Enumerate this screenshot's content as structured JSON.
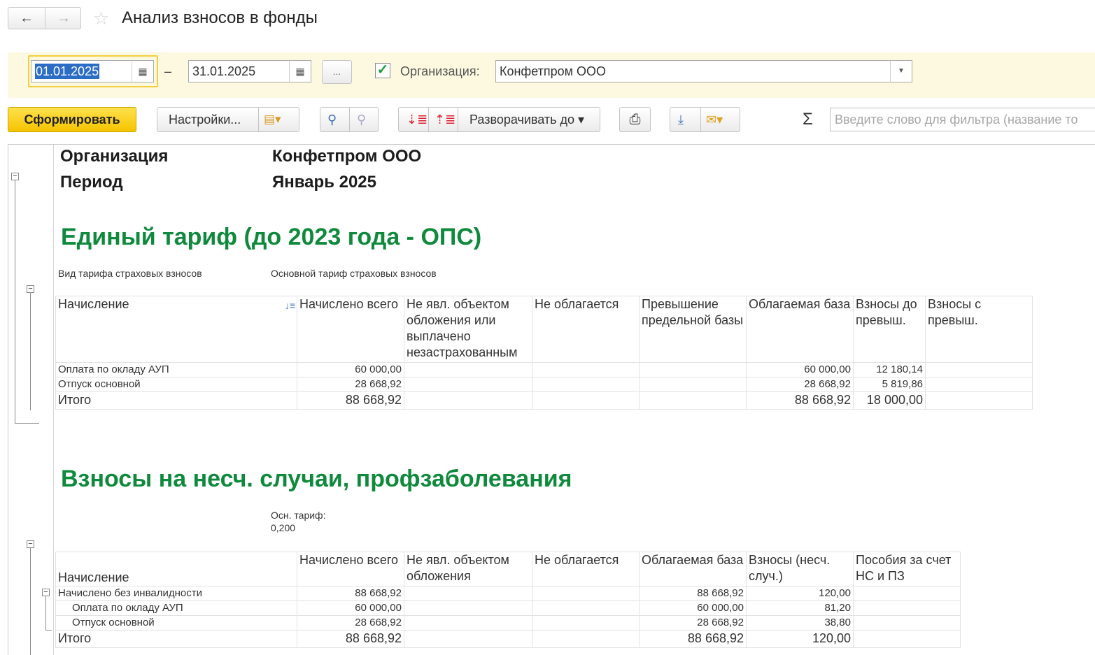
{
  "window": {
    "title": "Анализ взносов в фонды",
    "back_icon": "arrow-left-icon",
    "forward_icon": "arrow-right-icon",
    "favorite_icon": "star-icon"
  },
  "params": {
    "date_from": "01.01.2025",
    "dash": "–",
    "date_to": "31.01.2025",
    "period_button": "...",
    "org_checkbox_checked": true,
    "org_label": "Организация:",
    "org_value": "Конфетпром ООО"
  },
  "toolbar": {
    "generate": "Сформировать",
    "settings": "Настройки...",
    "expand_to": "Разворачивать до",
    "filter_placeholder": "Введите слово для фильтра (название то",
    "sum_symbol": "Σ"
  },
  "report": {
    "org_label": "Организация",
    "org_value": "Конфетпром ООО",
    "period_label": "Период",
    "period_value": "Январь 2025",
    "s1": {
      "title": "Единый тариф (до 2023 года - ОПС)",
      "tariff_label": "Вид тарифа страховых взносов",
      "tariff_value": "Основной тариф страховых взносов",
      "headers": [
        "Начисление",
        "Начислено всего",
        "Не явл. объектом обложения или выплачено незастрахованным",
        "Не облагается",
        "Превышение предельной базы",
        "Облагаемая база",
        "Взносы до превыш.",
        "Взносы с превыш."
      ],
      "rows": [
        {
          "name": "Оплата по окладу АУП",
          "total": "60 000,00",
          "base": "60 000,00",
          "before": "12 180,14"
        },
        {
          "name": "Отпуск основной",
          "total": "28 668,92",
          "base": "28 668,92",
          "before": "5 819,86"
        }
      ],
      "total": {
        "name": "Итого",
        "total": "88 668,92",
        "base": "88 668,92",
        "before": "18 000,00"
      }
    },
    "s2": {
      "title": "Взносы на несч. случаи, профзаболевания",
      "tariff_label": "Осн. тариф:",
      "tariff_value": "0,200",
      "headers": [
        "Начисление",
        "Начислено всего",
        "Не явл. объектом обложения",
        "Не облагается",
        "Облагаемая база",
        "Взносы (несч. случ.)",
        "Пособия за счет НС и ПЗ"
      ],
      "group": {
        "name": "Начислено без инвалидности",
        "total": "88 668,92",
        "base": "88 668,92",
        "contrib": "120,00"
      },
      "rows": [
        {
          "name": "Оплата по окладу АУП",
          "total": "60 000,00",
          "base": "60 000,00",
          "contrib": "81,20"
        },
        {
          "name": "Отпуск основной",
          "total": "28 668,92",
          "base": "28 668,92",
          "contrib": "38,80"
        }
      ],
      "total": {
        "name": "Итого",
        "total": "88 668,92",
        "base": "88 668,92",
        "contrib": "120,00"
      }
    }
  }
}
